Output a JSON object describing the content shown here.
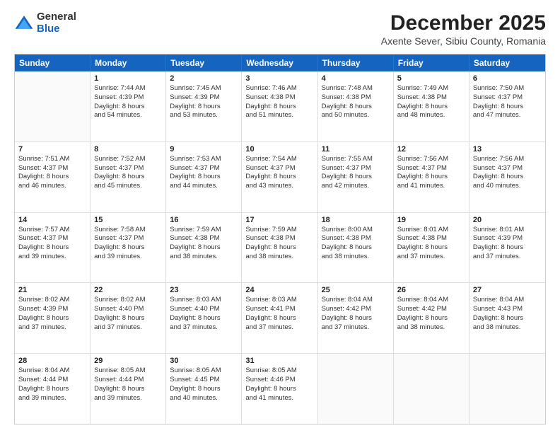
{
  "logo": {
    "general": "General",
    "blue": "Blue"
  },
  "title": "December 2025",
  "subtitle": "Axente Sever, Sibiu County, Romania",
  "header_days": [
    "Sunday",
    "Monday",
    "Tuesday",
    "Wednesday",
    "Thursday",
    "Friday",
    "Saturday"
  ],
  "weeks": [
    [
      {
        "day": "",
        "empty": true
      },
      {
        "day": "1",
        "sunrise": "Sunrise: 7:44 AM",
        "sunset": "Sunset: 4:39 PM",
        "daylight": "Daylight: 8 hours",
        "minutes": "and 54 minutes."
      },
      {
        "day": "2",
        "sunrise": "Sunrise: 7:45 AM",
        "sunset": "Sunset: 4:39 PM",
        "daylight": "Daylight: 8 hours",
        "minutes": "and 53 minutes."
      },
      {
        "day": "3",
        "sunrise": "Sunrise: 7:46 AM",
        "sunset": "Sunset: 4:38 PM",
        "daylight": "Daylight: 8 hours",
        "minutes": "and 51 minutes."
      },
      {
        "day": "4",
        "sunrise": "Sunrise: 7:48 AM",
        "sunset": "Sunset: 4:38 PM",
        "daylight": "Daylight: 8 hours",
        "minutes": "and 50 minutes."
      },
      {
        "day": "5",
        "sunrise": "Sunrise: 7:49 AM",
        "sunset": "Sunset: 4:38 PM",
        "daylight": "Daylight: 8 hours",
        "minutes": "and 48 minutes."
      },
      {
        "day": "6",
        "sunrise": "Sunrise: 7:50 AM",
        "sunset": "Sunset: 4:37 PM",
        "daylight": "Daylight: 8 hours",
        "minutes": "and 47 minutes."
      }
    ],
    [
      {
        "day": "7",
        "sunrise": "Sunrise: 7:51 AM",
        "sunset": "Sunset: 4:37 PM",
        "daylight": "Daylight: 8 hours",
        "minutes": "and 46 minutes."
      },
      {
        "day": "8",
        "sunrise": "Sunrise: 7:52 AM",
        "sunset": "Sunset: 4:37 PM",
        "daylight": "Daylight: 8 hours",
        "minutes": "and 45 minutes."
      },
      {
        "day": "9",
        "sunrise": "Sunrise: 7:53 AM",
        "sunset": "Sunset: 4:37 PM",
        "daylight": "Daylight: 8 hours",
        "minutes": "and 44 minutes."
      },
      {
        "day": "10",
        "sunrise": "Sunrise: 7:54 AM",
        "sunset": "Sunset: 4:37 PM",
        "daylight": "Daylight: 8 hours",
        "minutes": "and 43 minutes."
      },
      {
        "day": "11",
        "sunrise": "Sunrise: 7:55 AM",
        "sunset": "Sunset: 4:37 PM",
        "daylight": "Daylight: 8 hours",
        "minutes": "and 42 minutes."
      },
      {
        "day": "12",
        "sunrise": "Sunrise: 7:56 AM",
        "sunset": "Sunset: 4:37 PM",
        "daylight": "Daylight: 8 hours",
        "minutes": "and 41 minutes."
      },
      {
        "day": "13",
        "sunrise": "Sunrise: 7:56 AM",
        "sunset": "Sunset: 4:37 PM",
        "daylight": "Daylight: 8 hours",
        "minutes": "and 40 minutes."
      }
    ],
    [
      {
        "day": "14",
        "sunrise": "Sunrise: 7:57 AM",
        "sunset": "Sunset: 4:37 PM",
        "daylight": "Daylight: 8 hours",
        "minutes": "and 39 minutes."
      },
      {
        "day": "15",
        "sunrise": "Sunrise: 7:58 AM",
        "sunset": "Sunset: 4:37 PM",
        "daylight": "Daylight: 8 hours",
        "minutes": "and 39 minutes."
      },
      {
        "day": "16",
        "sunrise": "Sunrise: 7:59 AM",
        "sunset": "Sunset: 4:38 PM",
        "daylight": "Daylight: 8 hours",
        "minutes": "and 38 minutes."
      },
      {
        "day": "17",
        "sunrise": "Sunrise: 7:59 AM",
        "sunset": "Sunset: 4:38 PM",
        "daylight": "Daylight: 8 hours",
        "minutes": "and 38 minutes."
      },
      {
        "day": "18",
        "sunrise": "Sunrise: 8:00 AM",
        "sunset": "Sunset: 4:38 PM",
        "daylight": "Daylight: 8 hours",
        "minutes": "and 38 minutes."
      },
      {
        "day": "19",
        "sunrise": "Sunrise: 8:01 AM",
        "sunset": "Sunset: 4:38 PM",
        "daylight": "Daylight: 8 hours",
        "minutes": "and 37 minutes."
      },
      {
        "day": "20",
        "sunrise": "Sunrise: 8:01 AM",
        "sunset": "Sunset: 4:39 PM",
        "daylight": "Daylight: 8 hours",
        "minutes": "and 37 minutes."
      }
    ],
    [
      {
        "day": "21",
        "sunrise": "Sunrise: 8:02 AM",
        "sunset": "Sunset: 4:39 PM",
        "daylight": "Daylight: 8 hours",
        "minutes": "and 37 minutes."
      },
      {
        "day": "22",
        "sunrise": "Sunrise: 8:02 AM",
        "sunset": "Sunset: 4:40 PM",
        "daylight": "Daylight: 8 hours",
        "minutes": "and 37 minutes."
      },
      {
        "day": "23",
        "sunrise": "Sunrise: 8:03 AM",
        "sunset": "Sunset: 4:40 PM",
        "daylight": "Daylight: 8 hours",
        "minutes": "and 37 minutes."
      },
      {
        "day": "24",
        "sunrise": "Sunrise: 8:03 AM",
        "sunset": "Sunset: 4:41 PM",
        "daylight": "Daylight: 8 hours",
        "minutes": "and 37 minutes."
      },
      {
        "day": "25",
        "sunrise": "Sunrise: 8:04 AM",
        "sunset": "Sunset: 4:42 PM",
        "daylight": "Daylight: 8 hours",
        "minutes": "and 37 minutes."
      },
      {
        "day": "26",
        "sunrise": "Sunrise: 8:04 AM",
        "sunset": "Sunset: 4:42 PM",
        "daylight": "Daylight: 8 hours",
        "minutes": "and 38 minutes."
      },
      {
        "day": "27",
        "sunrise": "Sunrise: 8:04 AM",
        "sunset": "Sunset: 4:43 PM",
        "daylight": "Daylight: 8 hours",
        "minutes": "and 38 minutes."
      }
    ],
    [
      {
        "day": "28",
        "sunrise": "Sunrise: 8:04 AM",
        "sunset": "Sunset: 4:44 PM",
        "daylight": "Daylight: 8 hours",
        "minutes": "and 39 minutes."
      },
      {
        "day": "29",
        "sunrise": "Sunrise: 8:05 AM",
        "sunset": "Sunset: 4:44 PM",
        "daylight": "Daylight: 8 hours",
        "minutes": "and 39 minutes."
      },
      {
        "day": "30",
        "sunrise": "Sunrise: 8:05 AM",
        "sunset": "Sunset: 4:45 PM",
        "daylight": "Daylight: 8 hours",
        "minutes": "and 40 minutes."
      },
      {
        "day": "31",
        "sunrise": "Sunrise: 8:05 AM",
        "sunset": "Sunset: 4:46 PM",
        "daylight": "Daylight: 8 hours",
        "minutes": "and 41 minutes."
      },
      {
        "day": "",
        "empty": true
      },
      {
        "day": "",
        "empty": true
      },
      {
        "day": "",
        "empty": true
      }
    ]
  ]
}
